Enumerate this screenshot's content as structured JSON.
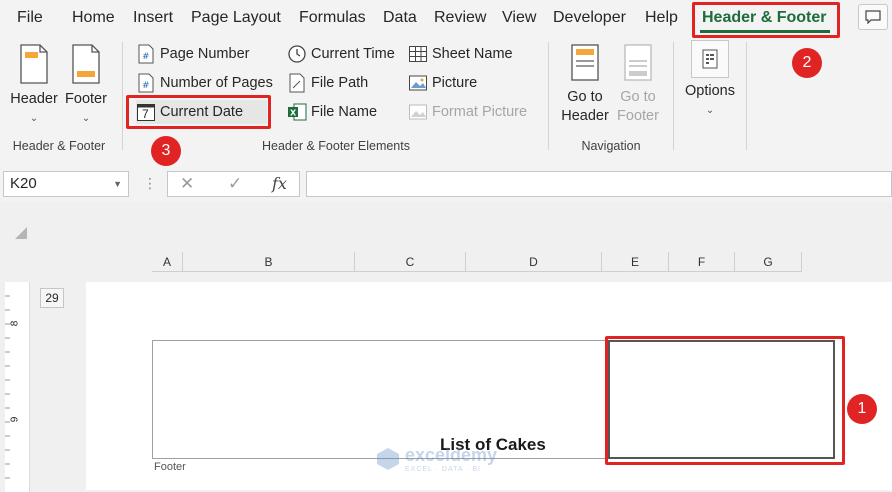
{
  "menu": {
    "tabs": [
      "File",
      "Home",
      "Insert",
      "Page Layout",
      "Formulas",
      "Data",
      "Review",
      "View",
      "Developer",
      "Help"
    ],
    "active_tab": "Header & Footer"
  },
  "ribbon": {
    "header_footer_group": {
      "header_label": "Header",
      "footer_label": "Footer",
      "group_label": "Header & Footer"
    },
    "elements_group": {
      "page_number": "Page Number",
      "number_of_pages": "Number of Pages",
      "current_date": "Current Date",
      "current_time": "Current Time",
      "file_path": "File Path",
      "file_name": "File Name",
      "sheet_name": "Sheet Name",
      "picture": "Picture",
      "format_picture": "Format Picture",
      "group_label": "Header & Footer Elements",
      "date_icon_digit": "7"
    },
    "navigation_group": {
      "go_to": "Go to",
      "header": "Header",
      "go_to_2": "Go to",
      "footer": "Footer",
      "group_label": "Navigation"
    },
    "options": {
      "label": "Options"
    }
  },
  "formula_bar": {
    "name_box": "K20",
    "cancel_glyph": "✕",
    "enter_glyph": "✓",
    "fx_glyph": "fx",
    "formula": ""
  },
  "sheet": {
    "columns": [
      "A",
      "B",
      "C",
      "D",
      "E",
      "F",
      "G"
    ],
    "row_number": "29",
    "ruler_marks": [
      "8",
      "9"
    ],
    "footer_label": "Footer",
    "title": "List of Cakes",
    "watermark_name": "exceldemy",
    "watermark_tag": "EXCEL · DATA · BI"
  },
  "annotations": {
    "badge_1": "1",
    "badge_2": "2",
    "badge_3": "3",
    "color": "#e02424"
  },
  "colors": {
    "accent_green": "#1e6b3c",
    "ribbon_bg": "#f3f3f3"
  }
}
